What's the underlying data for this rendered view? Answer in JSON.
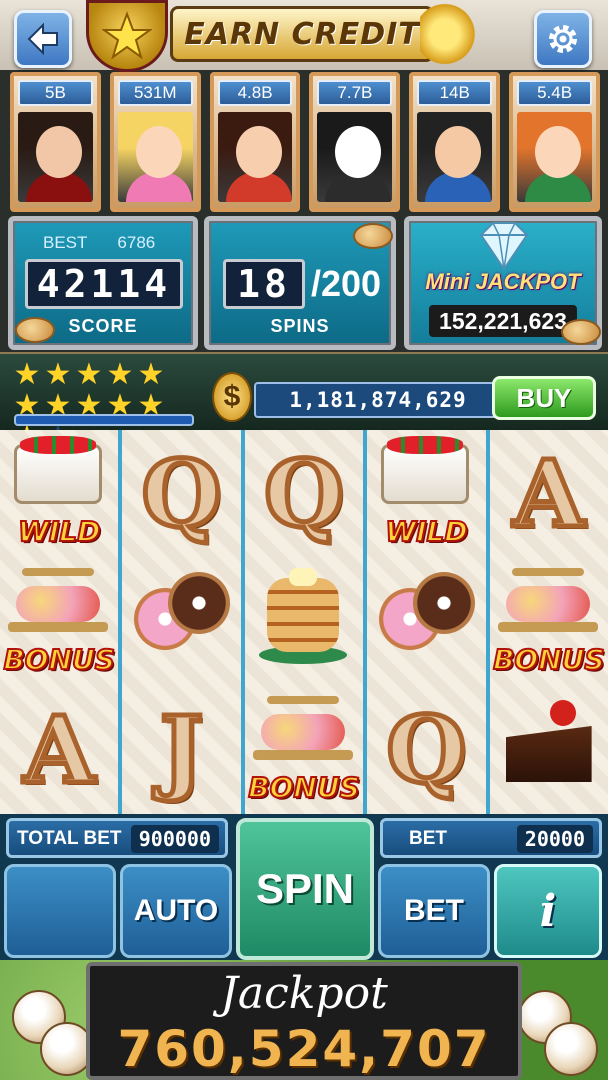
{
  "top_bar": {
    "title": "EARN CREDIT"
  },
  "players": [
    {
      "chips": "5B",
      "skin": "#f1c7a7",
      "hair": "#2a1a14",
      "outfit": "#8a1010"
    },
    {
      "chips": "531M",
      "skin": "#fbd6b9",
      "hair": "#f5d463",
      "outfit": "#f07bb4"
    },
    {
      "chips": "4.8B",
      "skin": "#f7cfae",
      "hair": "#3b1a10",
      "outfit": "#d23a2a"
    },
    {
      "chips": "7.7B",
      "skin": "#ffffff",
      "hair": "#1a1a1a",
      "outfit": "#2c2c2c"
    },
    {
      "chips": "14B",
      "skin": "#f4c9a3",
      "hair": "#222222",
      "outfit": "#2a62b8"
    },
    {
      "chips": "5.4B",
      "skin": "#fbd6b9",
      "hair": "#e2742c",
      "outfit": "#2e8b45"
    }
  ],
  "score_panel": {
    "best_label": "BEST",
    "best_value": "6786",
    "score_value": "42114",
    "label": "SCORE"
  },
  "spins_panel": {
    "current": "18",
    "max": "/200",
    "label": "SPINS"
  },
  "mini_jackpot": {
    "title": "Mini JACKPOT",
    "value": "152,221,623"
  },
  "level": {
    "stars_filled": 11,
    "stars_total": 12
  },
  "balance": {
    "currency_symbol": "$",
    "value": "1,181,874,629",
    "buy_label": "BUY"
  },
  "reels": [
    [
      {
        "symbol": "cake",
        "tag": "WILD"
      },
      {
        "symbol": "tier",
        "tag": "BONUS"
      },
      {
        "symbol": "letter",
        "letter": "A"
      }
    ],
    [
      {
        "symbol": "letter",
        "letter": "Q"
      },
      {
        "symbol": "donut",
        "tag": ""
      },
      {
        "symbol": "letter",
        "letter": "J"
      }
    ],
    [
      {
        "symbol": "letter",
        "letter": "Q"
      },
      {
        "symbol": "pancake",
        "tag": ""
      },
      {
        "symbol": "tier",
        "tag": "BONUS"
      }
    ],
    [
      {
        "symbol": "cake",
        "tag": "WILD"
      },
      {
        "symbol": "donut",
        "tag": ""
      },
      {
        "symbol": "letter",
        "letter": "Q"
      }
    ],
    [
      {
        "symbol": "letter",
        "letter": "A"
      },
      {
        "symbol": "tier",
        "tag": "BONUS"
      },
      {
        "symbol": "slice",
        "tag": ""
      }
    ]
  ],
  "controls": {
    "total_bet_label": "TOTAL BET",
    "total_bet_value": "900000",
    "bet_label": "BET",
    "bet_value": "20000",
    "auto_label": "AUTO",
    "spin_label": "SPIN",
    "bet_button_label": "BET",
    "info_label": "i"
  },
  "jackpot": {
    "title": "Jackpot",
    "value": "760,524,707"
  },
  "colors": {
    "reel_divider": "#3fa6d0",
    "button_blue": "#3c8fc6",
    "spin_green": "#1f8a65",
    "jackpot_gold": "#f0b451"
  }
}
